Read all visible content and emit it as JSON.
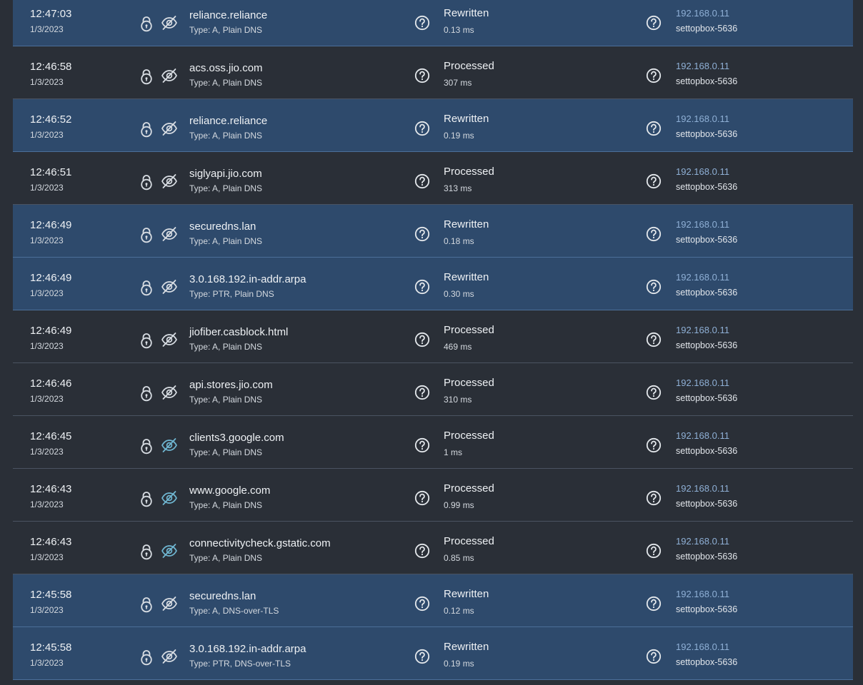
{
  "colors": {
    "row_default": "#2a2f37",
    "row_rewritten": "#2e4a6c",
    "ip_link": "#8fb0d6",
    "eye_dnssec": "#6fb6d1",
    "eye_default": "#d8dde3"
  },
  "rows": [
    {
      "time": "12:47:03",
      "date": "1/3/2023",
      "domain": "reliance.reliance",
      "type": "Type: A, Plain DNS",
      "status": "Rewritten",
      "elapsed": "0.13 ms",
      "ip": "192.168.0.11",
      "client": "settopbox-5636",
      "rewritten": true,
      "eye_icon": "eye-off-icon"
    },
    {
      "time": "12:46:58",
      "date": "1/3/2023",
      "domain": "acs.oss.jio.com",
      "type": "Type: A, Plain DNS",
      "status": "Processed",
      "elapsed": "307 ms",
      "ip": "192.168.0.11",
      "client": "settopbox-5636",
      "rewritten": false,
      "eye_icon": "eye-off-icon"
    },
    {
      "time": "12:46:52",
      "date": "1/3/2023",
      "domain": "reliance.reliance",
      "type": "Type: A, Plain DNS",
      "status": "Rewritten",
      "elapsed": "0.19 ms",
      "ip": "192.168.0.11",
      "client": "settopbox-5636",
      "rewritten": true,
      "eye_icon": "eye-off-icon"
    },
    {
      "time": "12:46:51",
      "date": "1/3/2023",
      "domain": "siglyapi.jio.com",
      "type": "Type: A, Plain DNS",
      "status": "Processed",
      "elapsed": "313 ms",
      "ip": "192.168.0.11",
      "client": "settopbox-5636",
      "rewritten": false,
      "eye_icon": "eye-off-icon"
    },
    {
      "time": "12:46:49",
      "date": "1/3/2023",
      "domain": "securedns.lan",
      "type": "Type: A, Plain DNS",
      "status": "Rewritten",
      "elapsed": "0.18 ms",
      "ip": "192.168.0.11",
      "client": "settopbox-5636",
      "rewritten": true,
      "eye_icon": "eye-off-icon"
    },
    {
      "time": "12:46:49",
      "date": "1/3/2023",
      "domain": "3.0.168.192.in-addr.arpa",
      "type": "Type: PTR, Plain DNS",
      "status": "Rewritten",
      "elapsed": "0.30 ms",
      "ip": "192.168.0.11",
      "client": "settopbox-5636",
      "rewritten": true,
      "eye_icon": "eye-off-icon"
    },
    {
      "time": "12:46:49",
      "date": "1/3/2023",
      "domain": "jiofiber.casblock.html",
      "type": "Type: A, Plain DNS",
      "status": "Processed",
      "elapsed": "469 ms",
      "ip": "192.168.0.11",
      "client": "settopbox-5636",
      "rewritten": false,
      "eye_icon": "eye-off-icon"
    },
    {
      "time": "12:46:46",
      "date": "1/3/2023",
      "domain": "api.stores.jio.com",
      "type": "Type: A, Plain DNS",
      "status": "Processed",
      "elapsed": "310 ms",
      "ip": "192.168.0.11",
      "client": "settopbox-5636",
      "rewritten": false,
      "eye_icon": "eye-off-icon"
    },
    {
      "time": "12:46:45",
      "date": "1/3/2023",
      "domain": "clients3.google.com",
      "type": "Type: A, Plain DNS",
      "status": "Processed",
      "elapsed": "1 ms",
      "ip": "192.168.0.11",
      "client": "settopbox-5636",
      "rewritten": false,
      "eye_icon": "eye-off-dnssec-icon"
    },
    {
      "time": "12:46:43",
      "date": "1/3/2023",
      "domain": "www.google.com",
      "type": "Type: A, Plain DNS",
      "status": "Processed",
      "elapsed": "0.99 ms",
      "ip": "192.168.0.11",
      "client": "settopbox-5636",
      "rewritten": false,
      "eye_icon": "eye-off-dnssec-icon"
    },
    {
      "time": "12:46:43",
      "date": "1/3/2023",
      "domain": "connectivitycheck.gstatic.com",
      "type": "Type: A, Plain DNS",
      "status": "Processed",
      "elapsed": "0.85 ms",
      "ip": "192.168.0.11",
      "client": "settopbox-5636",
      "rewritten": false,
      "eye_icon": "eye-off-dnssec-icon"
    },
    {
      "time": "12:45:58",
      "date": "1/3/2023",
      "domain": "securedns.lan",
      "type": "Type: A, DNS-over-TLS",
      "status": "Rewritten",
      "elapsed": "0.12 ms",
      "ip": "192.168.0.11",
      "client": "settopbox-5636",
      "rewritten": true,
      "eye_icon": "eye-off-icon"
    },
    {
      "time": "12:45:58",
      "date": "1/3/2023",
      "domain": "3.0.168.192.in-addr.arpa",
      "type": "Type: PTR, DNS-over-TLS",
      "status": "Rewritten",
      "elapsed": "0.19 ms",
      "ip": "192.168.0.11",
      "client": "settopbox-5636",
      "rewritten": true,
      "eye_icon": "eye-off-icon"
    }
  ]
}
